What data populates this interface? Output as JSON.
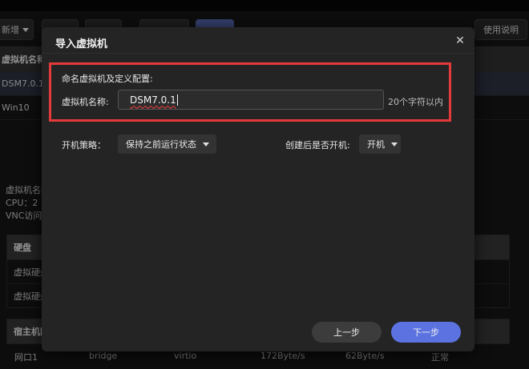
{
  "toolbar": {
    "new_label": "新增",
    "b2": "",
    "b3": "",
    "b4": "",
    "b5": "",
    "help_label": "使用说明"
  },
  "vm_table": {
    "header": "虚拟机名称",
    "rows": [
      "DSM7.0.1",
      "Win10"
    ]
  },
  "details": {
    "name_line": "虚拟机名称",
    "cpu_line": "CPU：2",
    "vnc_line": "VNC访问"
  },
  "disk_table": {
    "header": "硬盘",
    "rows": [
      "虚拟硬盘",
      "虚拟硬盘"
    ]
  },
  "host_table": {
    "header": "宿主机网",
    "row": [
      "网口1",
      "bridge",
      "virtio",
      "172Byte/s",
      "62Byte/s",
      "正常"
    ]
  },
  "dialog": {
    "title": "导入虚拟机",
    "section_label": "命名虚拟机及定义配置:",
    "name_label": "虚拟机名称:",
    "name_value": "DSM7.0.1",
    "name_hint": "20个字符以内",
    "boot_label": "开机策略：",
    "boot_value": "保持之前运行状态",
    "start_label": "创建后是否开机:",
    "start_value": "开机",
    "prev_label": "上一步",
    "next_label": "下一步"
  },
  "colors": {
    "highlight": "#e53a3a",
    "primary_button": "#5b72e0"
  },
  "icons": {
    "close": "close-icon",
    "dropdown": "chevron-down-icon"
  }
}
